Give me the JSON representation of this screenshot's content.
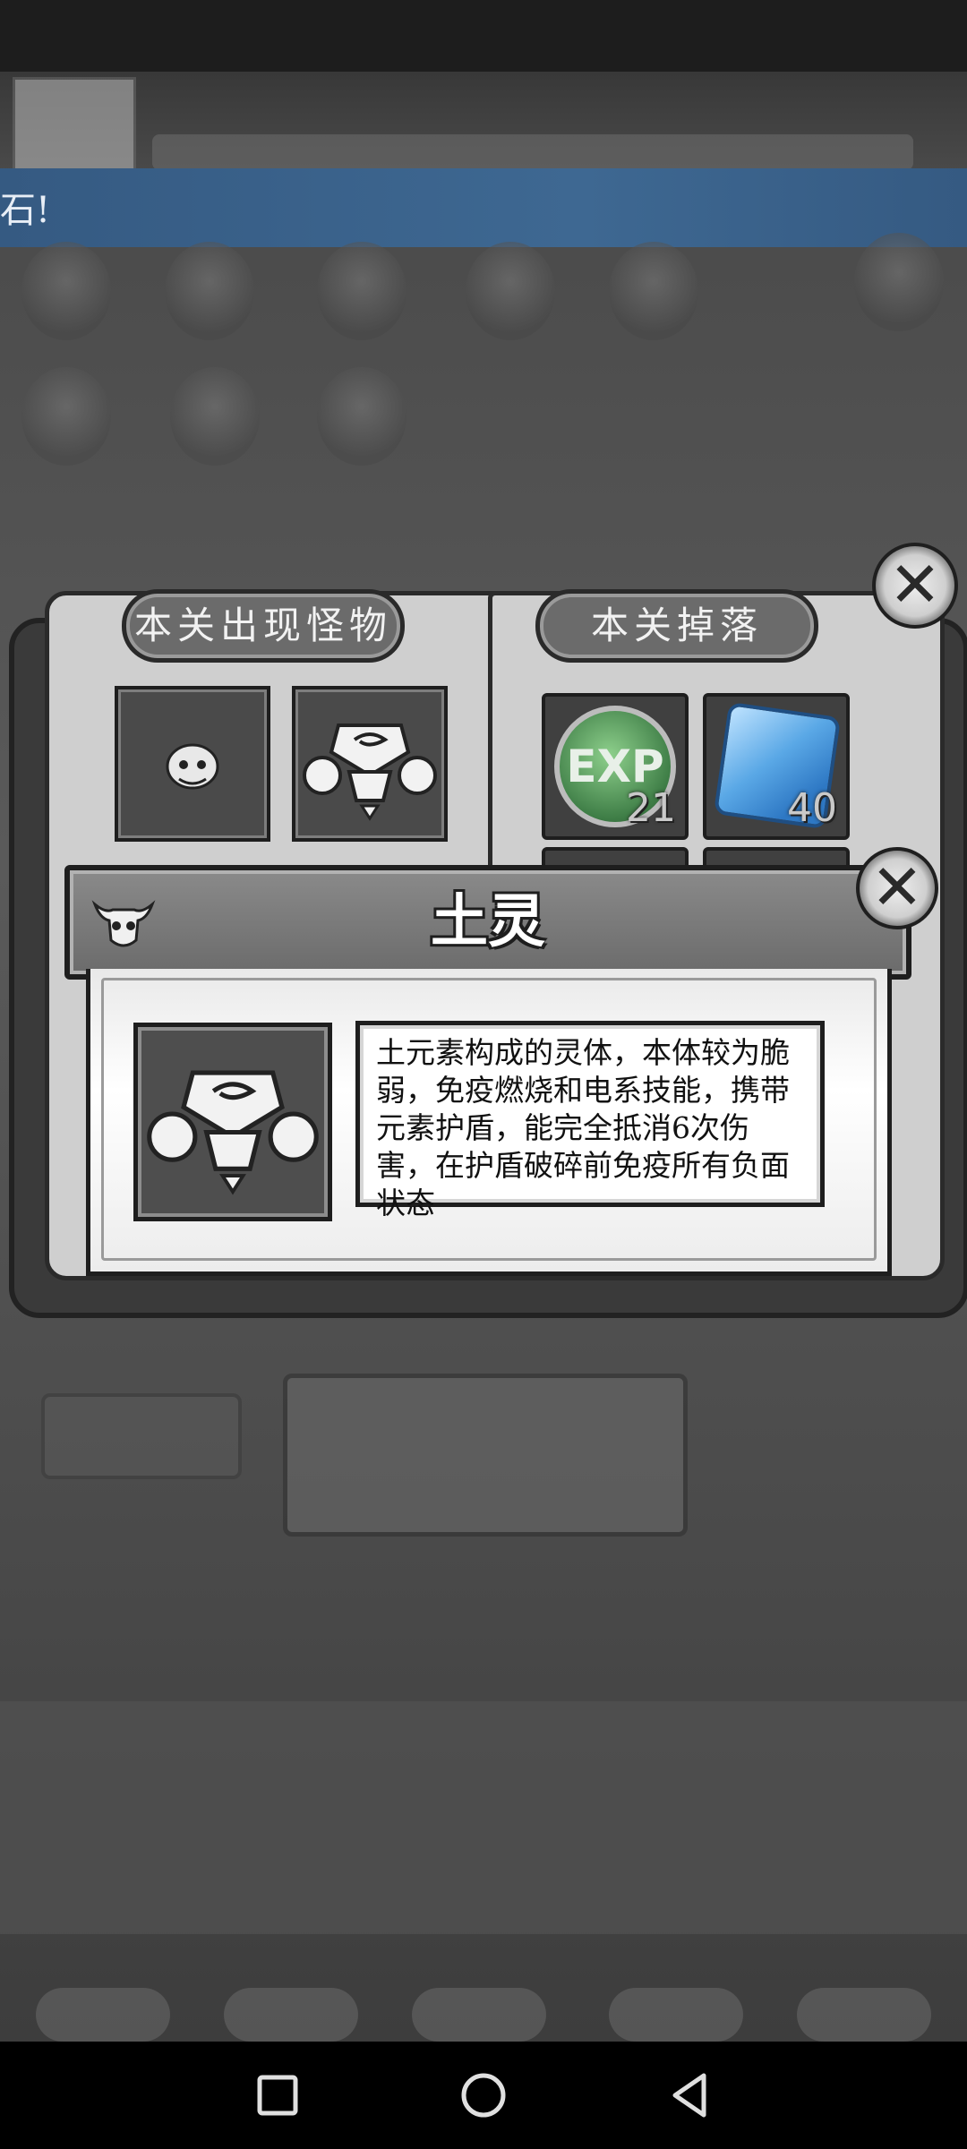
{
  "background": {
    "marquee_text": "石!"
  },
  "book": {
    "left_title": "本关出现怪物",
    "right_title": "本关掉落",
    "drops": [
      {
        "label": "EXP",
        "count": "21"
      },
      {
        "label": "gem",
        "count": "40"
      }
    ]
  },
  "detail": {
    "name": "土灵",
    "description": "土元素构成的灵体，本体较为脆弱，免疫燃烧和电系技能，携带元素护盾，能完全抵消6次伤害，在护盾破碎前免疫所有负面状态"
  },
  "colors": {
    "marquee": "#3e6892",
    "exp_orb": "#3e7d46",
    "gem": "#5aa8e6"
  }
}
